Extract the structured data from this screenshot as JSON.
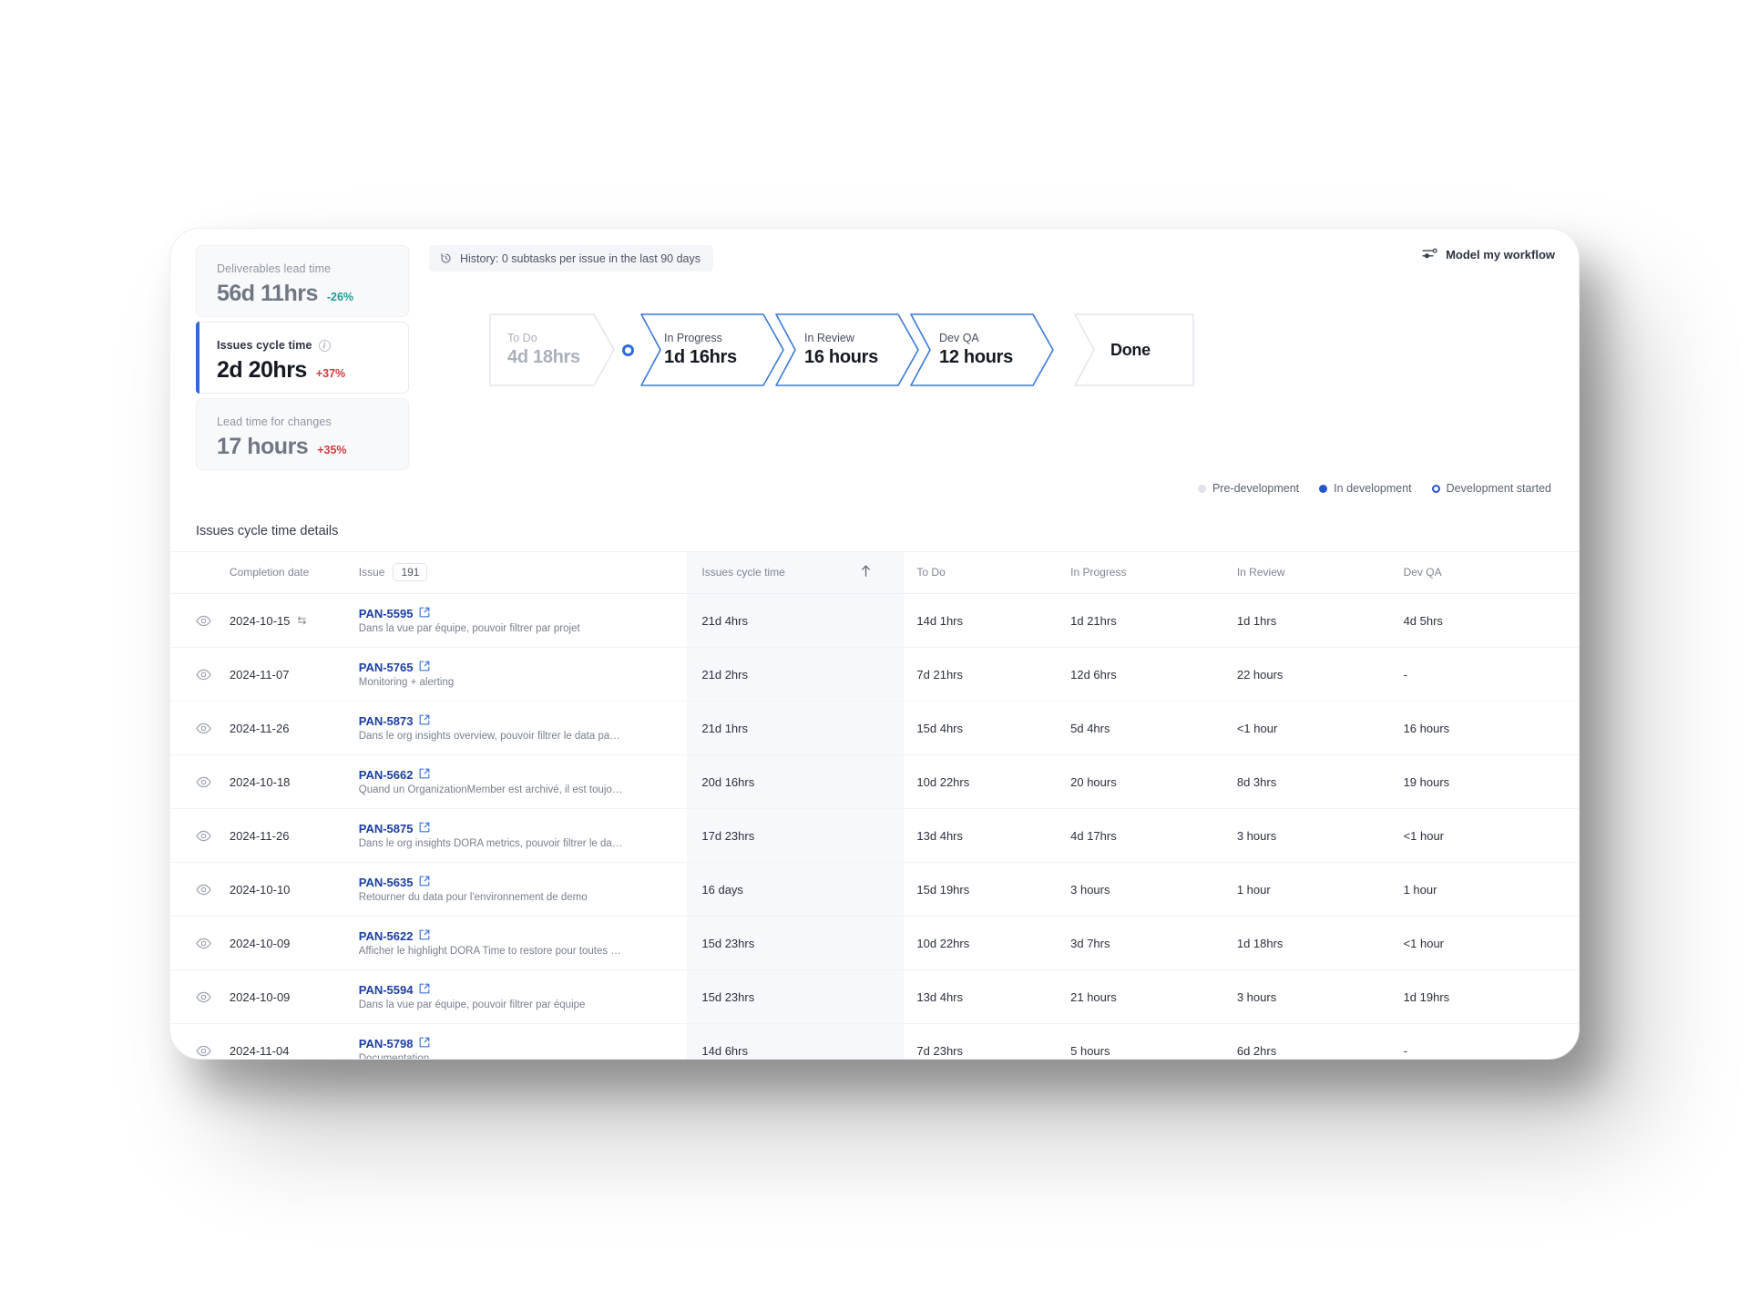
{
  "metrics": [
    {
      "label": "Deliverables lead time",
      "value": "56d 11hrs",
      "delta": "-26%",
      "trend": "down",
      "active": false,
      "info": false
    },
    {
      "label": "Issues cycle time",
      "value": "2d 20hrs",
      "delta": "+37%",
      "trend": "up",
      "active": true,
      "info": true
    },
    {
      "label": "Lead time for changes",
      "value": "17 hours",
      "delta": "+35%",
      "trend": "up",
      "active": false,
      "info": false
    }
  ],
  "flow_panel": {
    "history_text": "History: 0 subtasks per issue in the last 90 days",
    "history_icon": "history-clock-icon",
    "model_button_label": "Model my workflow",
    "model_button_icon": "workflow-settings-icon",
    "stages": [
      {
        "name": "To Do",
        "value": "4d 18hrs",
        "style": "grey"
      },
      {
        "name": "In Progress",
        "value": "1d 16hrs",
        "style": "blue"
      },
      {
        "name": "In Review",
        "value": "16 hours",
        "style": "blue"
      },
      {
        "name": "Dev QA",
        "value": "12 hours",
        "style": "blue"
      },
      {
        "name": "Done",
        "value": "Done",
        "style": "done"
      }
    ],
    "legend": [
      {
        "label": "Pre-development",
        "marker": "grey"
      },
      {
        "label": "In development",
        "marker": "solid"
      },
      {
        "label": "Development started",
        "marker": "ring"
      }
    ]
  },
  "table": {
    "title": "Issues cycle time details",
    "issue_count": "191",
    "sort_icon": "sort-ascending-arrow-icon",
    "headers": {
      "eye": "",
      "date": "Completion date",
      "issue": "Issue",
      "cycle": "Issues cycle time",
      "todo": "To Do",
      "progress": "In Progress",
      "review": "In Review",
      "qa": "Dev QA"
    },
    "rows": [
      {
        "date": "2024-10-15",
        "swap": true,
        "key": "PAN-5595",
        "desc": "Dans la vue par équipe, pouvoir filtrer par projet",
        "cycle": "21d 4hrs",
        "todo": "14d 1hrs",
        "progress": "1d 21hrs",
        "review": "1d 1hrs",
        "qa": "4d 5hrs"
      },
      {
        "date": "2024-11-07",
        "swap": false,
        "key": "PAN-5765",
        "desc": "Monitoring + alerting",
        "cycle": "21d 2hrs",
        "todo": "7d 21hrs",
        "progress": "12d 6hrs",
        "review": "22 hours",
        "qa": "-"
      },
      {
        "date": "2024-11-26",
        "swap": false,
        "key": "PAN-5873",
        "desc": "Dans le org insights overview, pouvoir filtrer le data par group…",
        "cycle": "21d 1hrs",
        "todo": "15d 4hrs",
        "progress": "5d 4hrs",
        "review": "<1 hour",
        "qa": "16 hours"
      },
      {
        "date": "2024-10-18",
        "swap": false,
        "key": "PAN-5662",
        "desc": "Quand un OrganizationMember est archivé, il est toujours con…",
        "cycle": "20d 16hrs",
        "todo": "10d 22hrs",
        "progress": "20 hours",
        "review": "8d 3hrs",
        "qa": "19 hours"
      },
      {
        "date": "2024-11-26",
        "swap": false,
        "key": "PAN-5875",
        "desc": "Dans le org insights DORA metrics, pouvoir filtrer le data par g…",
        "cycle": "17d 23hrs",
        "todo": "13d 4hrs",
        "progress": "4d 17hrs",
        "review": "3 hours",
        "qa": "<1 hour"
      },
      {
        "date": "2024-10-10",
        "swap": false,
        "key": "PAN-5635",
        "desc": "Retourner du data pour l'environnement de demo",
        "cycle": "16 days",
        "todo": "15d 19hrs",
        "progress": "3 hours",
        "review": "1 hour",
        "qa": "1 hour"
      },
      {
        "date": "2024-10-09",
        "swap": false,
        "key": "PAN-5622",
        "desc": "Afficher le highlight DORA Time to restore pour toutes les équi…",
        "cycle": "15d 23hrs",
        "todo": "10d 22hrs",
        "progress": "3d 7hrs",
        "review": "1d 18hrs",
        "qa": "<1 hour"
      },
      {
        "date": "2024-10-09",
        "swap": false,
        "key": "PAN-5594",
        "desc": "Dans la vue par équipe, pouvoir filtrer par équipe",
        "cycle": "15d 23hrs",
        "todo": "13d 4hrs",
        "progress": "21 hours",
        "review": "3 hours",
        "qa": "1d 19hrs"
      },
      {
        "date": "2024-11-04",
        "swap": false,
        "key": "PAN-5798",
        "desc": "Documentation",
        "cycle": "14d 6hrs",
        "todo": "7d 23hrs",
        "progress": "5 hours",
        "review": "6d 2hrs",
        "qa": "-"
      }
    ]
  },
  "colors": {
    "accent_blue": "#2f6bd8",
    "link_blue": "#1b3fa0",
    "delta_up_red": "#d23c3c",
    "delta_down_teal": "#1f9a92",
    "cycle_col_bg": "#f6f8fc"
  }
}
